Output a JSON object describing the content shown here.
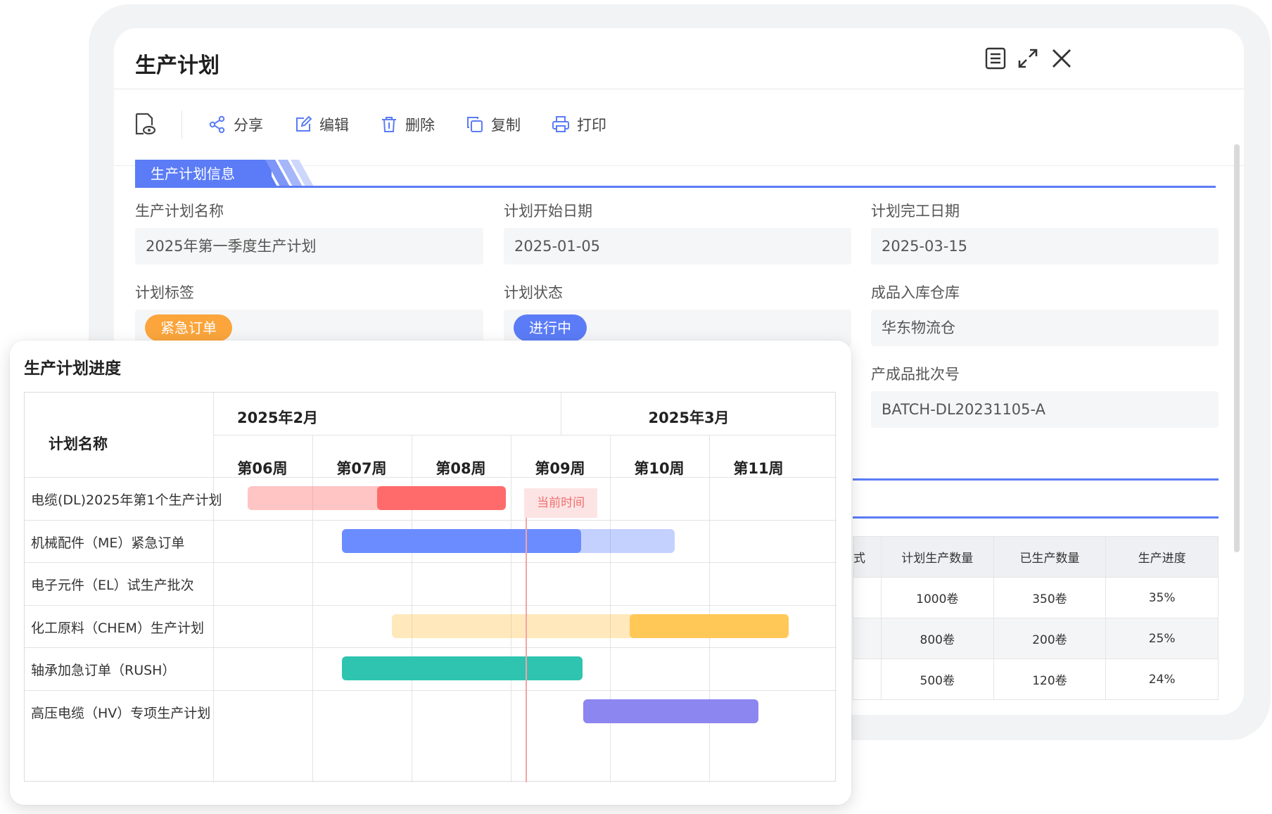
{
  "dialog": {
    "title": "生产计划"
  },
  "toolbar": {
    "share": "分享",
    "edit": "编辑",
    "delete": "删除",
    "copy": "复制",
    "print": "打印"
  },
  "section": {
    "title": "生产计划信息"
  },
  "fields": {
    "plan_name": {
      "label": "生产计划名称",
      "value": "2025年第一季度生产计划"
    },
    "start_date": {
      "label": "计划开始日期",
      "value": "2025-01-05"
    },
    "end_date": {
      "label": "计划完工日期",
      "value": "2025-03-15"
    },
    "tag": {
      "label": "计划标签",
      "value": "紧急订单"
    },
    "status": {
      "label": "计划状态",
      "value": "进行中"
    },
    "warehouse": {
      "label": "成品入库仓库",
      "value": "华东物流仓"
    },
    "batch_no": {
      "label": "产成品批次号",
      "value": "BATCH-DL20231105-A"
    }
  },
  "colors": {
    "accent": "#5b7cf6",
    "tag_orange": "#fba53c",
    "status_blue": "#5b7cf6"
  },
  "table": {
    "headers": [
      "式",
      "计划生产数量",
      "已生产数量",
      "生产进度"
    ],
    "rows": [
      [
        "",
        "1000卷",
        "350卷",
        "35%"
      ],
      [
        "",
        "800卷",
        "200卷",
        "25%"
      ],
      [
        "",
        "500卷",
        "120卷",
        "24%"
      ]
    ]
  },
  "gantt": {
    "title": "生产计划进度",
    "name_header": "计划名称",
    "months": [
      "2025年2月",
      "2025年3月"
    ],
    "weeks": [
      "第06周",
      "第07周",
      "第08周",
      "第09周",
      "第10周",
      "第11周"
    ],
    "now_label": "当前时间",
    "rows": [
      {
        "name": "电缆(DL)2025年第1个生产计划",
        "color": "#ff6b6b",
        "start": 0.35,
        "end": 2.95,
        "progress": 0.5
      },
      {
        "name": "机械配件（ME）紧急订单",
        "color": "#6b8cff",
        "start": 1.3,
        "end": 4.65,
        "progress": 0.72
      },
      {
        "name": "电子元件（EL）试生产批次",
        "color": "",
        "start": null,
        "end": null,
        "progress": null
      },
      {
        "name": "化工原料（CHEM）生产计划",
        "color": "#ffc857",
        "start": 1.8,
        "end": 5.8,
        "progress": 0.4
      },
      {
        "name": "轴承加急订单（RUSH）",
        "color": "#2ec4b0",
        "start": 1.3,
        "end": 3.72,
        "progress": 1.0
      },
      {
        "name": "高压电缆（HV）专项生产计划",
        "color": "#8c86f0",
        "start": 3.73,
        "end": 5.5,
        "progress": 1.0
      }
    ],
    "now_week_position": 3.15
  }
}
